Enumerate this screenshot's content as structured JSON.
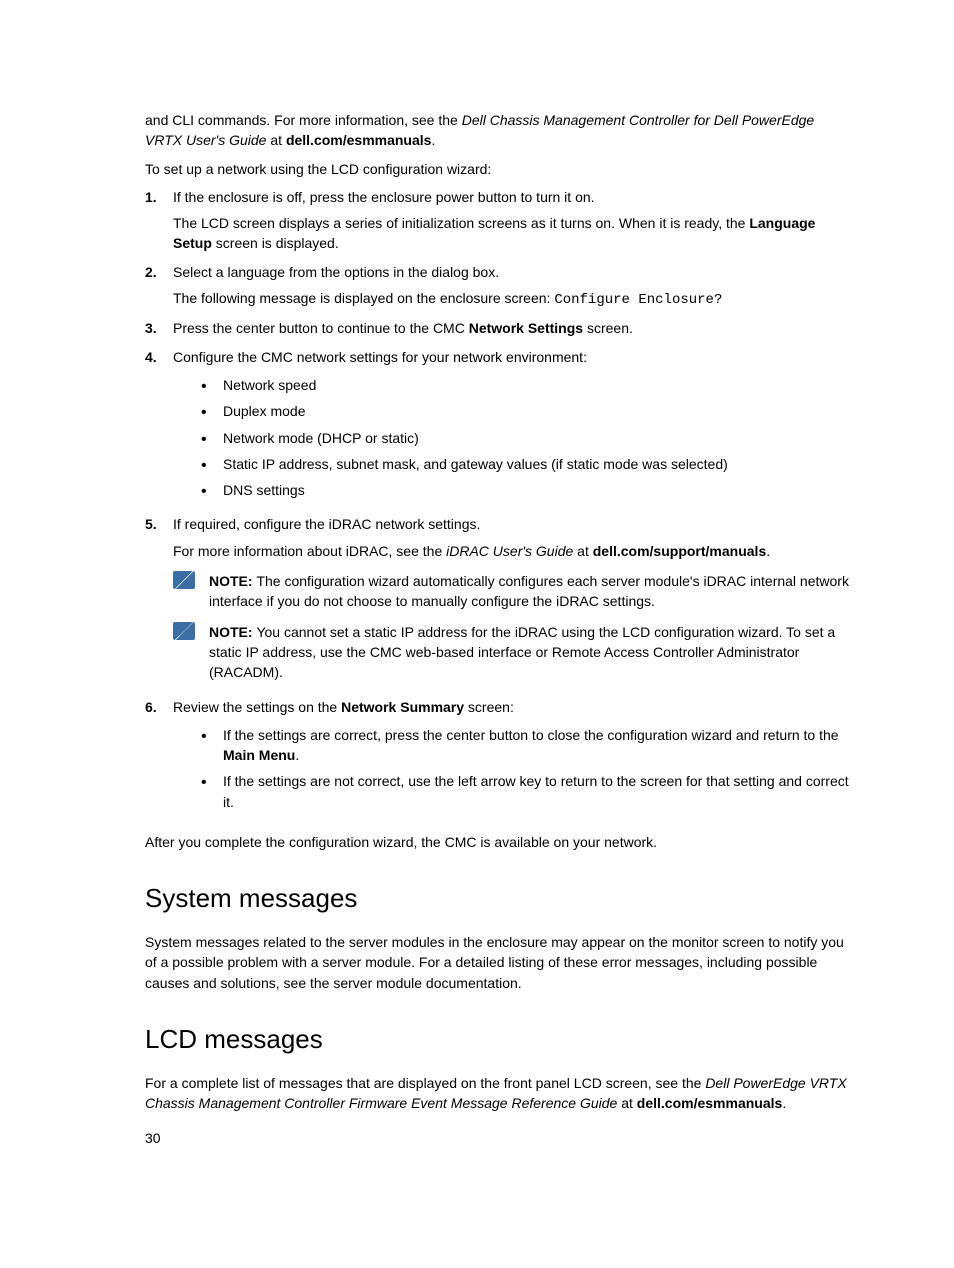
{
  "intro": {
    "frag_pre": "and CLI commands. For more information, see the ",
    "frag_em": "Dell Chassis Management Controller for Dell PowerEdge VRTX User's Guide",
    "frag_at": " at ",
    "frag_link": "dell.com/esmmanuals",
    "frag_end": "."
  },
  "lead": "To set up a network using the LCD configuration wizard:",
  "steps": [
    {
      "num": "1.",
      "p1_a": "If the enclosure is off, press the enclosure power button to turn it on.",
      "p2_a": "The LCD screen displays a series of initialization screens as it turns on. When it is ready, the ",
      "p2_b": "Language Setup",
      "p2_c": " screen is displayed."
    },
    {
      "num": "2.",
      "p1_a": "Select a language from the options in the dialog box.",
      "p2_a": "The following message is displayed on the enclosure screen: ",
      "p2_mono": "Configure Enclosure?"
    },
    {
      "num": "3.",
      "p1_a": "Press the center button to continue to the CMC ",
      "p1_b": "Network Settings",
      "p1_c": " screen."
    },
    {
      "num": "4.",
      "p1_a": "Configure the CMC network settings for your network environment:",
      "bullets": [
        "Network speed",
        "Duplex mode",
        "Network mode (DHCP or static)",
        "Static IP address, subnet mask, and gateway values (if static mode was selected)",
        "DNS settings"
      ]
    },
    {
      "num": "5.",
      "p1_a": "If required, configure the iDRAC network settings.",
      "p2_a": "For more information about iDRAC, see the ",
      "p2_em": "iDRAC User's Guide",
      "p2_at": " at ",
      "p2_link": "dell.com/support/manuals",
      "p2_end": ".",
      "note1_label": "NOTE: ",
      "note1_text": "The configuration wizard automatically configures each server module's iDRAC internal network interface if you do not choose to manually configure the iDRAC settings.",
      "note2_label": "NOTE: ",
      "note2_text": "You cannot set a static IP address for the iDRAC using the LCD configuration wizard. To set a static IP address, use the CMC web-based interface or Remote Access Controller Administrator (RACADM)."
    },
    {
      "num": "6.",
      "p1_a": "Review the settings on the ",
      "p1_b": "Network Summary",
      "p1_c": " screen:",
      "b1_a": "If the settings are correct, press the center button to close the configuration wizard and return to the ",
      "b1_b": "Main Menu",
      "b1_c": ".",
      "b2": "If the settings are not correct, use the left arrow key to return to the screen for that setting and correct it."
    }
  ],
  "after": "After you complete the configuration wizard, the CMC is available on your network.",
  "sys_heading": "System messages",
  "sys_para": "System messages related to the server modules in the enclosure may appear on the monitor screen to notify you of a possible problem with a server module. For a detailed listing of these error messages, including possible causes and solutions, see the server module documentation.",
  "lcd_heading": "LCD messages",
  "lcd_para": {
    "a": "For a complete list of messages that are displayed on the front panel LCD screen, see the ",
    "em": "Dell PowerEdge VRTX Chassis Management Controller Firmware Event Message Reference Guide",
    "at": " at ",
    "link": "dell.com/esmmanuals",
    "end": "."
  },
  "pagenum": "30"
}
